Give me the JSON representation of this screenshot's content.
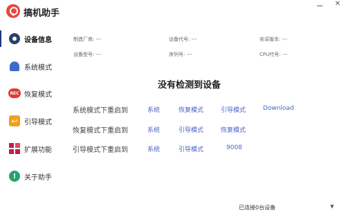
{
  "app": {
    "title": "搞机助手",
    "minimize_icon": "minimize-icon",
    "close_icon": "close-icon",
    "close_glyph": "✕"
  },
  "sidebar": {
    "items": [
      {
        "label": "设备信息",
        "icon": "gear-icon",
        "active": true
      },
      {
        "label": "系统模式",
        "icon": "android-icon"
      },
      {
        "label": "恢复模式",
        "icon": "rec-icon",
        "icon_text": "REC"
      },
      {
        "label": "引导模式",
        "icon": "back-arrow-icon"
      },
      {
        "label": "扩展功能",
        "icon": "grid-icon"
      },
      {
        "label": "关于助手",
        "icon": "info-icon"
      }
    ]
  },
  "device_info": {
    "manufacturer": "制造厂商: ---",
    "device_code": "设备代号: ---",
    "android_version": "安卓版本: ---",
    "model": "设备型号: ---",
    "serial": "序列号: ---",
    "cpu_code": "CPU代号: ---"
  },
  "main": {
    "no_device": "没有检测到设备"
  },
  "reboot": {
    "system": {
      "label": "系统模式下重启到",
      "options": [
        "系统",
        "恢复模式",
        "引导模式",
        "Download"
      ]
    },
    "recovery": {
      "label": "恢复模式下重启到",
      "options": [
        "系统",
        "引导模式",
        "恢复模式"
      ]
    },
    "bootloader": {
      "label": "引导模式下重启到",
      "options": [
        "系统",
        "引导模式",
        "9008"
      ]
    }
  },
  "status_bar": {
    "connected": "已连接0台设备",
    "dropdown_glyph": "▼"
  },
  "colors": {
    "accent": "#4a63c8",
    "nav_active": "#1e3a78",
    "logo": "#e8463f"
  }
}
